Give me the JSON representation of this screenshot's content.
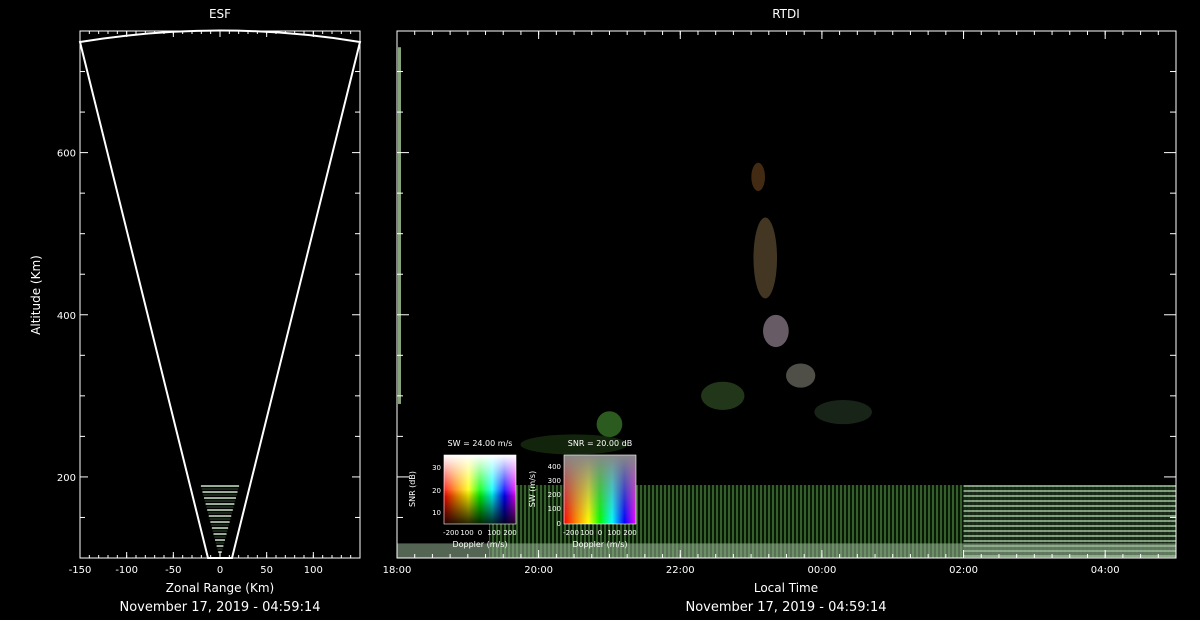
{
  "chart_data": [
    {
      "type": "heatmap",
      "title": "ESF",
      "xlabel": "Zonal Range (Km)",
      "ylabel": "Altitude (Km)",
      "xlim": [
        -150,
        150
      ],
      "ylim": [
        100,
        750
      ],
      "x_ticks": [
        "-150",
        "-100",
        "-50",
        "0",
        "50",
        "100"
      ],
      "x_tick_values": [
        -150,
        -100,
        -50,
        0,
        50,
        100
      ],
      "y_ticks": [
        "200",
        "400",
        "600"
      ],
      "y_tick_values": [
        200,
        400,
        600
      ],
      "timestamp": "November 17, 2019 - 04:59:14",
      "fan": {
        "half_angle_deg": 21.5,
        "max_range_km": 750
      },
      "echo_region": {
        "alt_min": 100,
        "alt_max": 190
      }
    },
    {
      "type": "heatmap",
      "title": "RTDI",
      "xlabel": "Local Time",
      "x_ticks": [
        "18:00",
        "20:00",
        "22:00",
        "00:00",
        "02:00",
        "04:00"
      ],
      "x_tick_hours": [
        18,
        20,
        22,
        24,
        26,
        28
      ],
      "xlim_hours": [
        18,
        29
      ],
      "ylim": [
        100,
        750
      ],
      "y_tick_values": [
        200,
        400,
        600
      ],
      "timestamp": "November 17, 2019 - 04:59:14",
      "plumes": [
        {
          "t": 21.0,
          "alt": 265,
          "w": 0.25,
          "h": 22,
          "color": "#3a7a2a"
        },
        {
          "t": 22.6,
          "alt": 300,
          "w": 0.5,
          "h": 25,
          "color": "#2d4a22"
        },
        {
          "t": 23.2,
          "alt": 470,
          "w": 0.22,
          "h": 90,
          "color": "#5a4a30"
        },
        {
          "t": 23.35,
          "alt": 380,
          "w": 0.25,
          "h": 30,
          "color": "#8a7a88"
        },
        {
          "t": 23.7,
          "alt": 325,
          "w": 0.3,
          "h": 20,
          "color": "#6a6a60"
        },
        {
          "t": 23.1,
          "alt": 570,
          "w": 0.08,
          "h": 25,
          "color": "#5a3a1a"
        },
        {
          "t": 24.3,
          "alt": 280,
          "w": 0.7,
          "h": 20,
          "color": "#223022"
        },
        {
          "t": 20.5,
          "alt": 240,
          "w": 1.4,
          "h": 15,
          "color": "#1a3010"
        }
      ],
      "bottom_layer": {
        "alt_min": 100,
        "alt_max": 190,
        "t_start": 19.3,
        "t_end": 29
      }
    }
  ],
  "legends": {
    "sw_key": {
      "title": "SW = 24.00 m/s",
      "ylabel": "SNR (dB)",
      "xlabel": "Doppler (m/s)",
      "x_ticks": [
        "-200",
        "100",
        "0",
        "100",
        "200"
      ],
      "y_ticks": [
        "30",
        "20",
        "10"
      ]
    },
    "snr_key": {
      "title": "SNR = 20.00 dB",
      "ylabel": "SW (m/s)",
      "xlabel": "Doppler (m/s)",
      "x_ticks": [
        "-200",
        "100",
        "0",
        "100",
        "200"
      ],
      "y_ticks": [
        "400",
        "300",
        "200",
        "100",
        "0"
      ]
    }
  }
}
